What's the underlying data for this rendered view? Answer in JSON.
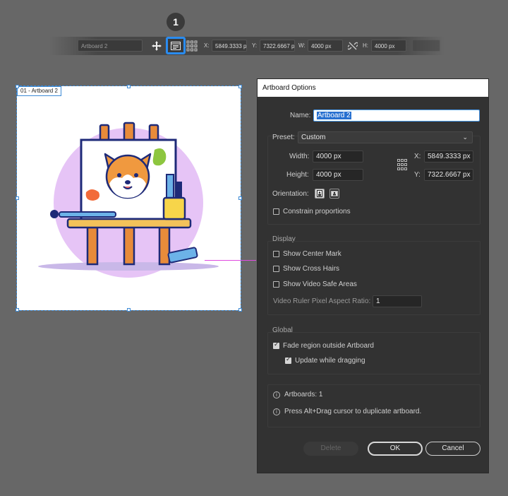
{
  "toolbar": {
    "badge": "1",
    "artboard_name": "Artboard 2",
    "x_label": "X:",
    "x_value": "5849.3333 p",
    "y_label": "Y:",
    "y_value": "7322.6667 p",
    "w_label": "W:",
    "w_value": "4000 px",
    "h_label": "H:",
    "h_value": "4000 px"
  },
  "artboard": {
    "label": "01 - Artboard 2"
  },
  "dialog": {
    "title": "Artboard Options",
    "name_label": "Name:",
    "name_value": "Artboard 2",
    "preset_label": "Preset:",
    "preset_value": "Custom",
    "width_label": "Width:",
    "width_value": "4000 px",
    "height_label": "Height:",
    "height_value": "4000 px",
    "x_label": "X:",
    "x_value": "5849.3333 px",
    "y_label": "Y:",
    "y_value": "7322.6667 px",
    "orientation_label": "Orientation:",
    "constrain_label": "Constrain proportions",
    "display_heading": "Display",
    "show_center_mark": "Show Center Mark",
    "show_cross_hairs": "Show Cross Hairs",
    "show_video_safe": "Show Video Safe Areas",
    "video_ratio_label": "Video Ruler Pixel Aspect Ratio:",
    "video_ratio_value": "1",
    "global_heading": "Global",
    "fade_region": "Fade region outside Artboard",
    "update_dragging": "Update while dragging",
    "artboards_count": "Artboards: 1",
    "hint": "Press Alt+Drag cursor to duplicate artboard.",
    "delete_button": "Delete",
    "ok_button": "OK",
    "cancel_button": "Cancel"
  },
  "colors": {
    "highlight": "#2a8cf0",
    "artboard_border": "#3c8ad6",
    "selection_line": "#e04be0"
  }
}
